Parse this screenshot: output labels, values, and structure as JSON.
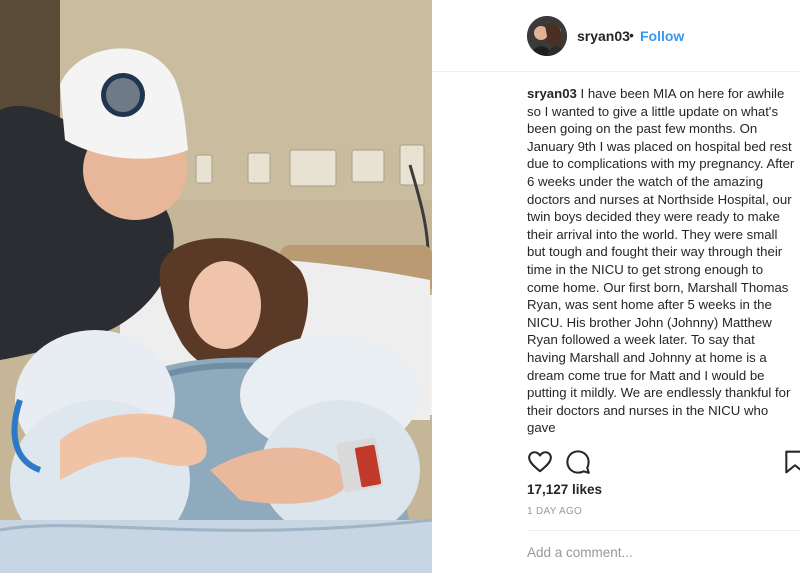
{
  "post": {
    "photo_alt": "",
    "username": "sryan03",
    "separator": "•",
    "follow_label": "Follow",
    "caption_user": "sryan03",
    "caption_text": " I have been MIA on here for awhile so I wanted to give a little update on what's been going on the past few months. On January 9th I was placed on hospital bed rest due to complications with my pregnancy. After 6 weeks under the watch of the amazing doctors and nurses at Northside Hospital, our twin boys decided they were ready to make their arrival into the world. They were small but tough and fought their way through their time in the NICU to get strong enough to come home. Our first born, Marshall Thomas Ryan, was sent home after 5 weeks in the NICU. His brother John (Johnny) Matthew Ryan followed a week later. To say that having Marshall and Johnny at home is a dream come true for Matt and I would be putting it mildly. We are endlessly thankful for their doctors and nurses in the NICU who gave",
    "likes": "17,127 likes",
    "timestamp": "1 DAY AGO",
    "comment_placeholder": "Add a comment..."
  },
  "icons": {
    "like": "heart-outline-icon",
    "comment": "speech-bubble-icon",
    "save": "bookmark-icon"
  },
  "colors": {
    "link_blue": "#3897f0",
    "text": "#262626",
    "muted": "#999999",
    "border": "#efefef"
  }
}
